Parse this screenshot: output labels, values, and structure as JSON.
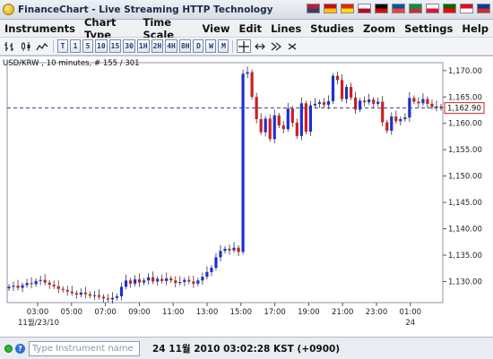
{
  "app": {
    "title": "FinanceChart - Live Streaming HTTP Technology"
  },
  "flags": [
    {
      "name": "us-flag",
      "c1": "#b22234",
      "c2": "#3c3b6e"
    },
    {
      "name": "es-flag",
      "c1": "#c60b1e",
      "c2": "#ffc400"
    },
    {
      "name": "cn-flag",
      "c1": "#de2910",
      "c2": "#ffde00"
    },
    {
      "name": "jp-flag",
      "c1": "#ffffff",
      "c2": "#bc002d"
    },
    {
      "name": "de-flag",
      "c1": "#000000",
      "c2": "#dd0000"
    },
    {
      "name": "fr-flag",
      "c1": "#0055a4",
      "c2": "#ef4135"
    },
    {
      "name": "it-flag",
      "c1": "#009246",
      "c2": "#ce2b37"
    },
    {
      "name": "pl-flag",
      "c1": "#ffffff",
      "c2": "#dc143c"
    },
    {
      "name": "pt-flag",
      "c1": "#006600",
      "c2": "#ff0000"
    },
    {
      "name": "tr-flag",
      "c1": "#e30a17",
      "c2": "#ffffff"
    },
    {
      "name": "ru-flag",
      "c1": "#0039a6",
      "c2": "#d52b1e"
    }
  ],
  "menu": {
    "instruments": "Instruments",
    "chart_type": "Chart Type",
    "time_scale": "Time Scale",
    "view": "View",
    "edit": "Edit",
    "lines": "Lines",
    "studies": "Studies",
    "zoom": "Zoom",
    "settings": "Settings",
    "help": "Help"
  },
  "toolbar": {
    "bar_icon": "bar-chart-icon",
    "candle_icon": "candlestick-icon",
    "line_icon": "line-chart-icon",
    "timeframes": [
      "T",
      "1",
      "5",
      "10",
      "15",
      "30",
      "1H",
      "2H",
      "4H",
      "8H",
      "D",
      "W",
      "M"
    ],
    "crosshair_icon": "crosshair-icon",
    "pan_icon": "pan-icon",
    "zoom_in_icon": "zoom-in-icon",
    "zoom_out_icon": "zoom-out-icon"
  },
  "chart": {
    "label": "USD/KRW , 10 minutes, # 155 / 301",
    "current_price": "1,162.90"
  },
  "chart_data": {
    "type": "candlestick",
    "instrument": "USD/KRW",
    "interval": "10 minutes",
    "y_ticks": [
      "1,130.00",
      "1,135.00",
      "1,140.00",
      "1,145.00",
      "1,150.00",
      "1,155.00",
      "1,160.00",
      "1,165.00",
      "1,170.00"
    ],
    "ylim": [
      1126,
      1171.5
    ],
    "x_ticks": [
      "03:00",
      "05:00",
      "07:00",
      "09:00",
      "11:00",
      "13:00",
      "15:00",
      "17:00",
      "19:00",
      "21:00",
      "23:00",
      "01:00"
    ],
    "x_subticks": [
      "11월/23/10",
      "24"
    ],
    "current_price": 1162.9,
    "up_color": "#1c2fd6",
    "down_color": "#cc1f1f",
    "closes": [
      1129.0,
      1129.2,
      1128.8,
      1129.3,
      1129.7,
      1129.5,
      1130.1,
      1130.3,
      1129.8,
      1129.4,
      1129.1,
      1128.6,
      1128.4,
      1128.1,
      1127.8,
      1127.5,
      1127.9,
      1127.6,
      1127.3,
      1127.4,
      1127.1,
      1126.8,
      1126.6,
      1126.9,
      1127.2,
      1129.0,
      1130.2,
      1129.6,
      1130.4,
      1129.8,
      1130.2,
      1130.8,
      1130.0,
      1130.5,
      1130.1,
      1130.6,
      1130.2,
      1129.7,
      1129.9,
      1130.3,
      1130.0,
      1129.6,
      1130.2,
      1130.9,
      1131.8,
      1132.6,
      1134.6,
      1135.8,
      1136.2,
      1135.9,
      1136.4,
      1135.6,
      1169.4,
      1169.7,
      1165.0,
      1160.8,
      1158.3,
      1160.9,
      1157.0,
      1161.5,
      1159.6,
      1158.9,
      1162.8,
      1160.1,
      1157.6,
      1163.8,
      1158.4,
      1163.4,
      1163.7,
      1164.0,
      1163.5,
      1164.2,
      1169.0,
      1168.2,
      1164.6,
      1166.9,
      1164.9,
      1162.6,
      1164.3,
      1164.0,
      1164.5,
      1163.7,
      1164.1,
      1160.2,
      1158.6,
      1161.3,
      1160.4,
      1160.8,
      1161.1,
      1164.8,
      1164.1,
      1163.8,
      1164.6,
      1163.7,
      1163.1,
      1163.2,
      1162.9
    ]
  },
  "status": {
    "input_placeholder": "Type Instrument name",
    "time": "24 11월 2010 03:02:28  KST (+0900)"
  }
}
